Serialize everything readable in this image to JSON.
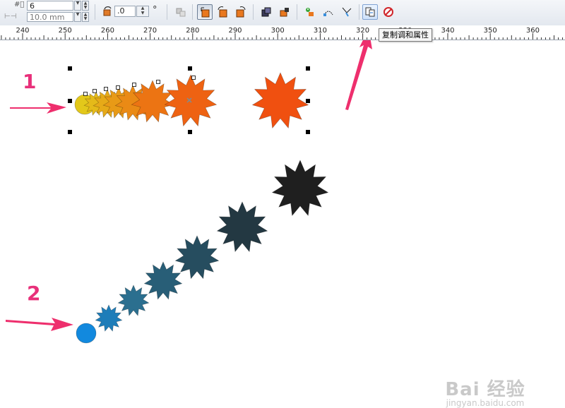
{
  "toolbar": {
    "steps_value": "6",
    "spacing_value": "10.0 mm",
    "rotation_value": ".0",
    "degree_symbol": "°",
    "tooltip_copy_blend": "复制调和属性"
  },
  "ruler": {
    "labels": [
      "240",
      "250",
      "260",
      "270",
      "280",
      "290",
      "300",
      "310",
      "320",
      "330",
      "340",
      "350",
      "360"
    ]
  },
  "canvas": {
    "label_1": "1",
    "label_2": "2"
  },
  "watermark": {
    "main": "Bai 经验",
    "sub": "jingyan.baidu.com"
  },
  "colors": {
    "blend1_start": "#e3c81a",
    "blend1_end": "#f05010",
    "blend2_start": "#1289de",
    "blend2_end": "#1f1f1f",
    "arrow": "#ee2f6d"
  }
}
